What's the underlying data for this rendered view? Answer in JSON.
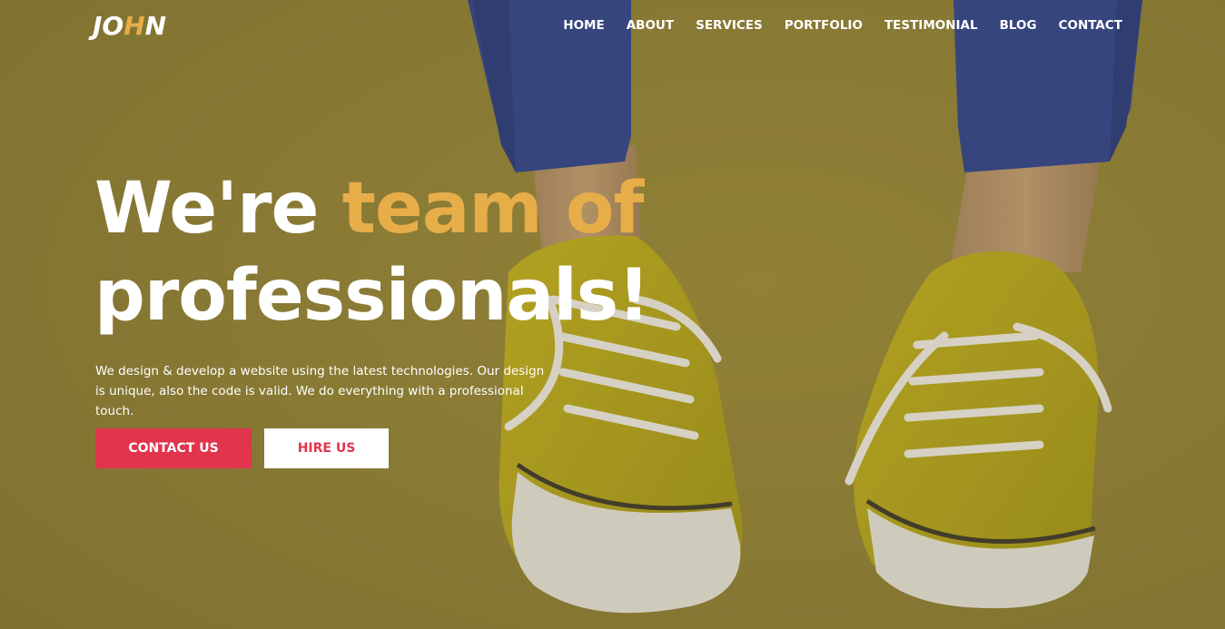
{
  "logo": {
    "part1": "JO",
    "part2": "H",
    "part3": "N"
  },
  "nav": {
    "items": [
      "HOME",
      "ABOUT",
      "SERVICES",
      "PORTFOLIO",
      "TESTIMONIAL",
      "BLOG",
      "CONTACT"
    ]
  },
  "hero": {
    "headline_line1_prefix": "We're ",
    "headline_line1_accent": "team of",
    "headline_line2": "professionals!",
    "description": "We design & develop a website using the latest technologies. Our design is unique, also the code is valid. We do everything with a professional touch.",
    "contact_button": "CONTACT US",
    "hire_button": "HIRE US"
  },
  "colors": {
    "accent": "#e7ad49",
    "primary_button": "#e0354d",
    "background": "#8c7a2e"
  }
}
